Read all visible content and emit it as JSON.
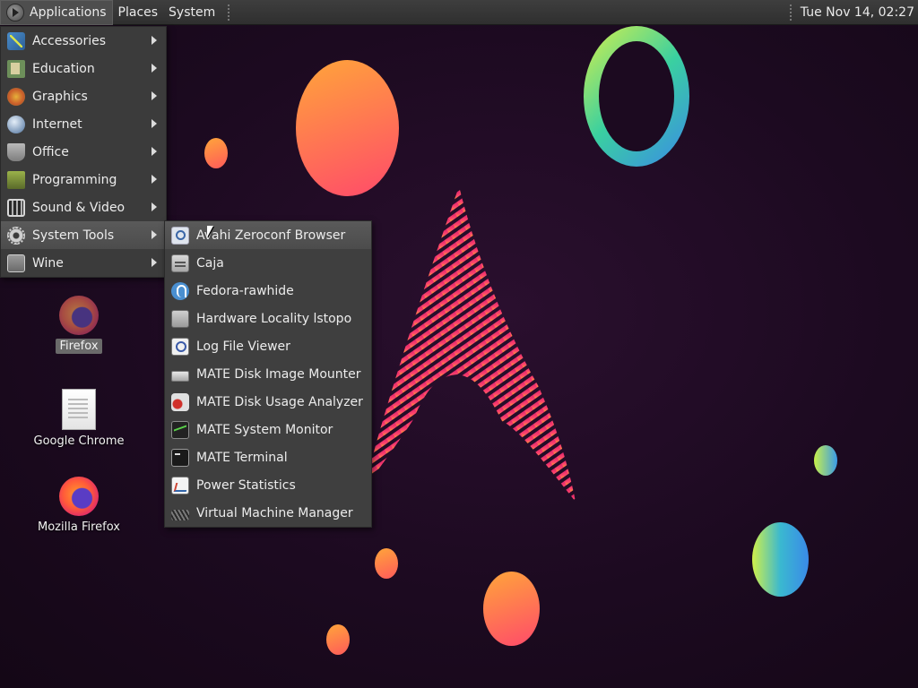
{
  "panel": {
    "applications_label": "Applications",
    "places_label": "Places",
    "system_label": "System",
    "clock": "Tue Nov 14, 02:27"
  },
  "main_menu": {
    "items": [
      {
        "label": "Accessories",
        "icon": "accessories-icon"
      },
      {
        "label": "Education",
        "icon": "education-icon"
      },
      {
        "label": "Graphics",
        "icon": "graphics-icon"
      },
      {
        "label": "Internet",
        "icon": "internet-icon"
      },
      {
        "label": "Office",
        "icon": "office-icon"
      },
      {
        "label": "Programming",
        "icon": "programming-icon"
      },
      {
        "label": "Sound & Video",
        "icon": "sound-video-icon"
      },
      {
        "label": "System Tools",
        "icon": "system-tools-icon"
      },
      {
        "label": "Wine",
        "icon": "wine-icon"
      }
    ],
    "highlighted": "System Tools"
  },
  "system_tools_menu": {
    "items": [
      {
        "label": "Avahi Zeroconf Browser",
        "icon": "avahi-icon"
      },
      {
        "label": "Caja",
        "icon": "caja-icon"
      },
      {
        "label": "Fedora-rawhide",
        "icon": "fedora-icon"
      },
      {
        "label": "Hardware Locality lstopo",
        "icon": "hardware-icon"
      },
      {
        "label": "Log File Viewer",
        "icon": "log-viewer-icon"
      },
      {
        "label": "MATE Disk Image Mounter",
        "icon": "disk-mounter-icon"
      },
      {
        "label": "MATE Disk Usage Analyzer",
        "icon": "disk-usage-icon"
      },
      {
        "label": "MATE System Monitor",
        "icon": "system-monitor-icon"
      },
      {
        "label": "MATE Terminal",
        "icon": "terminal-icon"
      },
      {
        "label": "Power Statistics",
        "icon": "power-statistics-icon"
      },
      {
        "label": "Virtual Machine Manager",
        "icon": "vmm-icon"
      }
    ],
    "highlighted": "Avahi Zeroconf Browser"
  },
  "desktop": {
    "icons": [
      {
        "label": "Firefox",
        "icon": "firefox-icon",
        "selected": true
      },
      {
        "label": "Google Chrome",
        "icon": "document-icon",
        "selected": false
      },
      {
        "label": "Mozilla Firefox",
        "icon": "firefox-icon",
        "selected": false
      }
    ]
  },
  "colors": {
    "panel_bg": "#333333",
    "menu_bg": "#3b3b3b",
    "highlight_bg": "#555555",
    "wallpaper_bg": "#1c0a20",
    "accent_pink": "#e0206e",
    "accent_orange": "#ffa030"
  }
}
